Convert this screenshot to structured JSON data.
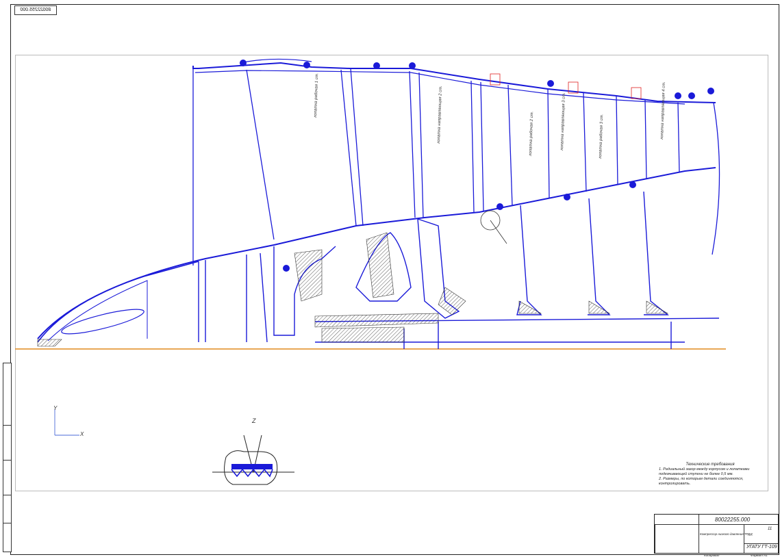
{
  "stamp": {
    "text": "80022255.000"
  },
  "axes": {
    "y_label": "Y",
    "x_label": "X"
  },
  "detail": {
    "label": "Z"
  },
  "blade_labels": [
    "лопатка рабочая 1 ст.",
    "лопатка направляющая 2 ст.",
    "лопатка рабочая 2 ст.",
    "лопатка направляющая 3 ст.",
    "лопатка рабочая 3 ст.",
    "лопатка направляющая 4 ст."
  ],
  "notes": {
    "title": "Технические требования",
    "lines": [
      "1. Радиальный зазор между корпусом и лопатками",
      "подкачивающей ступени не более 0,5 мм.",
      "2. Размеры, по которым детали соединяются,",
      "контролировать."
    ]
  },
  "title_block": {
    "code": "80022255.000",
    "name": "Компрессор низкого давления ТРДД",
    "sheet": "11",
    "org": "УГАТУ ГТ-109",
    "copied": "Копировал",
    "format": "Формат А1"
  },
  "colors": {
    "drawing": "#1a1ad8",
    "hatch": "#333333",
    "axis": "#e08a1f",
    "marker": "#e02020"
  }
}
